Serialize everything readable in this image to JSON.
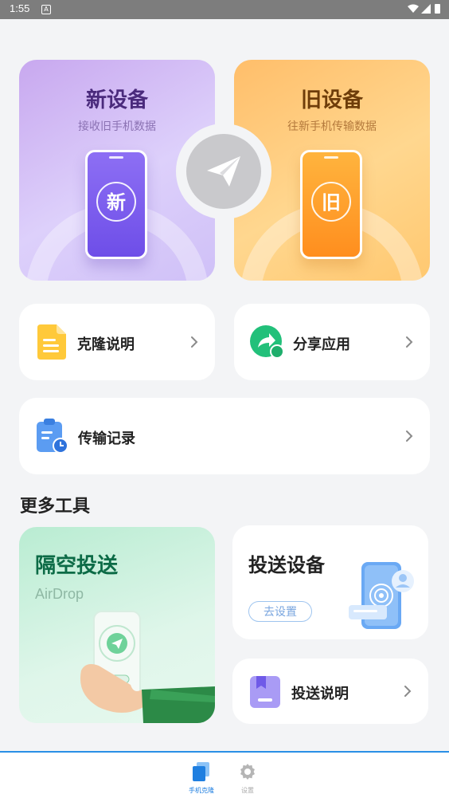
{
  "status_bar": {
    "time": "1:55"
  },
  "devices": {
    "new": {
      "title": "新设备",
      "subtitle": "接收旧手机数据",
      "badge": "新"
    },
    "old": {
      "title": "旧设备",
      "subtitle": "往新手机传输数据",
      "badge": "旧"
    }
  },
  "quick_actions": {
    "clone_guide": "克隆说明",
    "share_app": "分享应用",
    "transfer_history": "传输记录"
  },
  "more_tools": {
    "title": "更多工具",
    "airdrop": {
      "title": "隔空投送",
      "subtitle": "AirDrop"
    },
    "cast_device": {
      "title": "投送设备",
      "button": "去设置"
    },
    "cast_guide": "投送说明"
  },
  "bottom_nav": {
    "items": [
      {
        "label": "手机克隆",
        "active": true
      },
      {
        "label": "设置",
        "active": false
      }
    ]
  },
  "colors": {
    "accent": "#2a8fe6",
    "share_green": "#22c07a",
    "airdrop_green": "#0c6b46"
  }
}
